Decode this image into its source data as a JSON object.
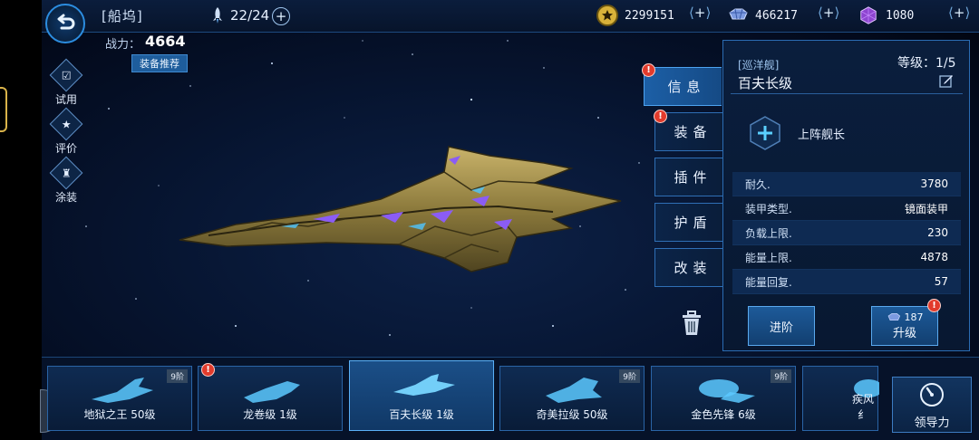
{
  "header": {
    "dock_title": "[船坞]",
    "fleet_count": "22/24",
    "resources": [
      {
        "name": "coins",
        "icon": "star-coin-icon",
        "value": "2299151",
        "color": "#d9b23a"
      },
      {
        "name": "crystal",
        "icon": "crystal-icon",
        "value": "466217",
        "color": "#6f8fd8"
      },
      {
        "name": "gem",
        "icon": "gem-icon",
        "value": "1080",
        "color": "#9a4fd8"
      }
    ]
  },
  "power": {
    "label": "战力：",
    "value": "4664",
    "recommend": "装备推荐"
  },
  "side_buttons": [
    {
      "label": "试用",
      "icon": "trial-icon"
    },
    {
      "label": "评价",
      "icon": "rating-icon"
    },
    {
      "label": "涂装",
      "icon": "paint-icon"
    }
  ],
  "tabs": [
    {
      "label": "信息",
      "active": true,
      "alert": true
    },
    {
      "label": "装备",
      "active": false,
      "alert": true
    },
    {
      "label": "插件",
      "active": false,
      "alert": false
    },
    {
      "label": "护盾",
      "active": false,
      "alert": false
    },
    {
      "label": "改装",
      "active": false,
      "alert": false
    }
  ],
  "alert_glyph": "!",
  "panel": {
    "ship_class": "[巡洋舰]",
    "ship_name": "百夫长级",
    "level": "等级：1/5",
    "captain_label": "上阵舰长",
    "stats": [
      {
        "label": "耐久.",
        "value": "3780"
      },
      {
        "label": "装甲类型.",
        "value": "镜面装甲"
      },
      {
        "label": "负载上限.",
        "value": "230"
      },
      {
        "label": "能量上限.",
        "value": "4878"
      },
      {
        "label": "能量回复.",
        "value": "57"
      }
    ],
    "advance_button": "进阶",
    "upgrade_button": "升级",
    "upgrade_cost": "187"
  },
  "ships": [
    {
      "name": "地狱之王 50级",
      "tier": "9阶",
      "alert": false,
      "selected": false
    },
    {
      "name": "龙卷级 1级",
      "tier": "",
      "alert": true,
      "selected": false
    },
    {
      "name": "百夫长级 1级",
      "tier": "",
      "alert": false,
      "selected": true
    },
    {
      "name": "奇美拉级 50级",
      "tier": "9阶",
      "alert": false,
      "selected": false
    },
    {
      "name": "金色先锋 6级",
      "tier": "9阶",
      "alert": false,
      "selected": false
    },
    {
      "name": "疾风纟",
      "tier": "",
      "alert": false,
      "selected": false
    }
  ],
  "guide_button": "领导力",
  "plus_glyph": "+"
}
